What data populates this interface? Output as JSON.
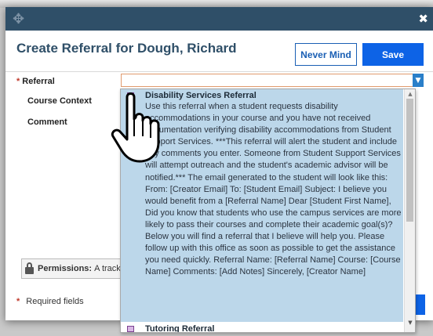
{
  "window": {
    "drag_icon": "move-icon",
    "close_glyph": "✖"
  },
  "dialog": {
    "title": "Create Referral for Dough, Richard",
    "never_mind_label": "Never Mind",
    "save_label": "Save"
  },
  "form": {
    "referral_label": "Referral",
    "course_context_label": "Course Context",
    "comment_label": "Comment",
    "required_star": "*",
    "referral_value": ""
  },
  "permissions": {
    "label": "Permissions:",
    "text": "A tracki"
  },
  "footer": {
    "required_star": "*",
    "required_text": "Required fields"
  },
  "dropdown": {
    "options": [
      {
        "title": "Disability Services Referral",
        "description": "Use this referral when a student requests disability accommodations in your course and you have not received documentation verifying disability accommodations from Student Support Services. ***This referral will alert the student and include any comments you enter. Someone from Student Support Services will attempt outreach and the student's academic advisor will be notified.*** The email generated to the student will look like this: From: [Creator Email] To: [Student Email] Subject: I believe you would benefit from a [Referral Name] Dear [Student First Name], Did you know that students who use the campus services are more likely to pass their courses and complete their academic goal(s)? Below you will find a referral that I believe will help you. Please follow up with this office as soon as possible to get the assistance you need quickly. Referral Name: [Referral Name] Course: [Course Name] Comments: [Add Notes] Sincerely, [Creator Name]"
      },
      {
        "title": "Tutoring Referral"
      }
    ]
  },
  "colors": {
    "titlebar": "#2f4f68",
    "accent_blue": "#0d63e6",
    "selected_option": "#bcd7ea",
    "required_star": "#c0392b"
  }
}
